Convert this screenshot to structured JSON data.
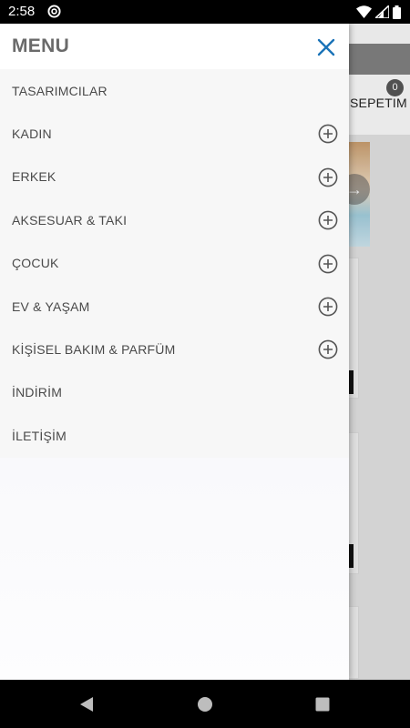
{
  "status_bar": {
    "time": "2:58",
    "icons": [
      "at-sign-icon",
      "wifi-icon",
      "cell-signal-icon",
      "battery-icon"
    ]
  },
  "background_app": {
    "cart_count": "0",
    "cart_label": "SEPETIM"
  },
  "drawer": {
    "title": "MENU",
    "close_icon": "close-icon",
    "accent_color": "#1a73b8",
    "items": [
      {
        "label": "TASARIMCILAR",
        "expandable": false
      },
      {
        "label": "KADIN",
        "expandable": true
      },
      {
        "label": "ERKEK",
        "expandable": true
      },
      {
        "label": "AKSESUAR & TAKI",
        "expandable": true
      },
      {
        "label": "ÇOCUK",
        "expandable": true
      },
      {
        "label": "EV & YAŞAM",
        "expandable": true
      },
      {
        "label": "KİŞİSEL BAKIM & PARFÜM",
        "expandable": true
      },
      {
        "label": "İNDİRİM",
        "expandable": false
      },
      {
        "label": "İLETİŞİM",
        "expandable": false
      }
    ]
  },
  "nav_bar": {
    "buttons": [
      "back-icon",
      "home-icon",
      "recents-icon"
    ]
  }
}
